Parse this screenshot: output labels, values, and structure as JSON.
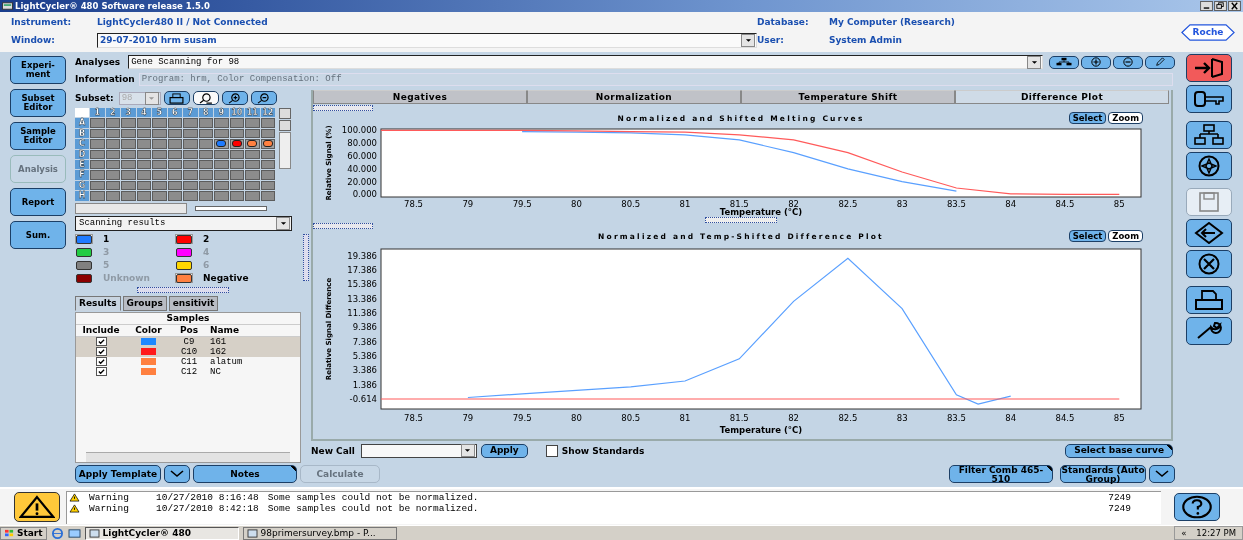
{
  "window": {
    "title": "LightCycler® 480 Software release 1.5.0"
  },
  "header": {
    "instrument_label": "Instrument:",
    "instrument": "LightCycler480 II / Not Connected",
    "window_label": "Window:",
    "window_value": "29-07-2010 hrm susam",
    "database_label": "Database:",
    "database": "My Computer (Research)",
    "user_label": "User:",
    "user": "System Admin",
    "logo": "Roche"
  },
  "nav": [
    {
      "label": "Experi-ment",
      "disabled": false
    },
    {
      "label": "Subset Editor",
      "disabled": false
    },
    {
      "label": "Sample Editor",
      "disabled": false
    },
    {
      "label": "Analysis",
      "disabled": true
    },
    {
      "label": "Report",
      "disabled": false
    },
    {
      "label": "Sum.",
      "disabled": false
    }
  ],
  "analyses": {
    "label": "Analyses",
    "value": "Gene Scanning for 98",
    "info_label": "Information",
    "info_placeholder": "Program: hrm, Color Compensation: Off"
  },
  "subset": {
    "label": "Subset:",
    "value": "98"
  },
  "plate": {
    "columns": [
      "1",
      "2",
      "3",
      "4",
      "5",
      "6",
      "7",
      "8",
      "9",
      "10",
      "11",
      "12"
    ],
    "rows": [
      {
        "label": "A",
        "wells": [
          {
            "occupied": false
          },
          {
            "occupied": false
          },
          {
            "occupied": false
          },
          {
            "occupied": false
          },
          {
            "occupied": false
          },
          {
            "occupied": false
          },
          {
            "occupied": false
          },
          {
            "occupied": false
          },
          {
            "occupied": false
          },
          {
            "occupied": false
          },
          {
            "occupied": false
          },
          {
            "occupied": false
          }
        ]
      },
      {
        "label": "B",
        "wells": [
          {
            "occupied": false
          },
          {
            "occupied": false
          },
          {
            "occupied": false
          },
          {
            "occupied": false
          },
          {
            "occupied": false
          },
          {
            "occupied": false
          },
          {
            "occupied": false
          },
          {
            "occupied": false
          },
          {
            "occupied": false
          },
          {
            "occupied": false
          },
          {
            "occupied": false
          },
          {
            "occupied": false
          }
        ]
      },
      {
        "label": "C",
        "wells": [
          {
            "occupied": false
          },
          {
            "occupied": false
          },
          {
            "occupied": false
          },
          {
            "occupied": false
          },
          {
            "occupied": false
          },
          {
            "occupied": false
          },
          {
            "occupied": false
          },
          {
            "occupied": false
          },
          {
            "occupied": true,
            "color": "#1e7bff"
          },
          {
            "occupied": true,
            "color": "#ff0000"
          },
          {
            "occupied": true,
            "color": "#ff8040"
          },
          {
            "occupied": true,
            "color": "#ff8040"
          }
        ]
      },
      {
        "label": "D",
        "wells": [
          {
            "occupied": false
          },
          {
            "occupied": false
          },
          {
            "occupied": false
          },
          {
            "occupied": false
          },
          {
            "occupied": false
          },
          {
            "occupied": false
          },
          {
            "occupied": false
          },
          {
            "occupied": false
          },
          {
            "occupied": false
          },
          {
            "occupied": false
          },
          {
            "occupied": false
          },
          {
            "occupied": false
          }
        ]
      },
      {
        "label": "E",
        "wells": [
          {
            "occupied": false
          },
          {
            "occupied": false
          },
          {
            "occupied": false
          },
          {
            "occupied": false
          },
          {
            "occupied": false
          },
          {
            "occupied": false
          },
          {
            "occupied": false
          },
          {
            "occupied": false
          },
          {
            "occupied": false
          },
          {
            "occupied": false
          },
          {
            "occupied": false
          },
          {
            "occupied": false
          }
        ]
      },
      {
        "label": "F",
        "wells": [
          {
            "occupied": false
          },
          {
            "occupied": false
          },
          {
            "occupied": false
          },
          {
            "occupied": false
          },
          {
            "occupied": false
          },
          {
            "occupied": false
          },
          {
            "occupied": false
          },
          {
            "occupied": false
          },
          {
            "occupied": false
          },
          {
            "occupied": false
          },
          {
            "occupied": false
          },
          {
            "occupied": false
          }
        ]
      },
      {
        "label": "G",
        "wells": [
          {
            "occupied": false
          },
          {
            "occupied": false
          },
          {
            "occupied": false
          },
          {
            "occupied": false
          },
          {
            "occupied": false
          },
          {
            "occupied": false
          },
          {
            "occupied": false
          },
          {
            "occupied": false
          },
          {
            "occupied": false
          },
          {
            "occupied": false
          },
          {
            "occupied": false
          },
          {
            "occupied": false
          }
        ]
      },
      {
        "label": "H",
        "wells": [
          {
            "occupied": false
          },
          {
            "occupied": false
          },
          {
            "occupied": false
          },
          {
            "occupied": false
          },
          {
            "occupied": false
          },
          {
            "occupied": false
          },
          {
            "occupied": false
          },
          {
            "occupied": false
          },
          {
            "occupied": false
          },
          {
            "occupied": false
          },
          {
            "occupied": false
          },
          {
            "occupied": false
          }
        ]
      }
    ]
  },
  "results_select": "Scanning results",
  "legend": [
    {
      "label": "1",
      "color": "#1e7bff",
      "active": true
    },
    {
      "label": "2",
      "color": "#ff0000",
      "active": true
    },
    {
      "label": "3",
      "color": "#22cc44",
      "active": false
    },
    {
      "label": "4",
      "color": "#ff00ff",
      "active": false
    },
    {
      "label": "5",
      "color": "#808080",
      "active": false
    },
    {
      "label": "6",
      "color": "#ffd700",
      "active": false
    },
    {
      "label": "Unknown",
      "color": "#8b0000",
      "active": false
    },
    {
      "label": "Negative",
      "color": "#ff8040",
      "active": true
    }
  ],
  "left_tabs": [
    {
      "label": "Results",
      "selected": true
    },
    {
      "label": "Groups",
      "selected": false
    },
    {
      "label": "ensitivit",
      "selected": false
    }
  ],
  "samples": {
    "title": "Samples",
    "columns": [
      "Include",
      "Color",
      "Pos",
      "Name"
    ],
    "rows": [
      {
        "include": true,
        "color": "#1e88ff",
        "pos": "C9",
        "name": "161",
        "selected": true
      },
      {
        "include": true,
        "color": "#ff1a1a",
        "pos": "C10",
        "name": "162",
        "selected": true
      },
      {
        "include": true,
        "color": "#ff8040",
        "pos": "C11",
        "name": "alatum",
        "selected": false
      },
      {
        "include": true,
        "color": "#ff8040",
        "pos": "C12",
        "name": "NC",
        "selected": false
      }
    ]
  },
  "chart_tabs": [
    {
      "label": "Negatives",
      "selected": false
    },
    {
      "label": "Normalization",
      "selected": false
    },
    {
      "label": "Temperature Shift",
      "selected": false
    },
    {
      "label": "Difference Plot",
      "selected": true
    }
  ],
  "charts": [
    {
      "select": "Select",
      "zoom": "Zoom",
      "chart_data": {
        "type": "line",
        "title": "Normalized and Shifted Melting Curves",
        "xlabel": "Temperature (°C)",
        "ylabel": "Relative Signal (%)",
        "x": [
          78.2,
          78.5,
          79,
          79.5,
          80,
          80.5,
          81,
          81.5,
          82,
          82.5,
          83,
          83.5,
          84,
          84.5,
          85
        ],
        "series": [
          {
            "color": "#5aa0ff",
            "values": [
              null,
              null,
              null,
              98,
              97,
              96,
              93,
              85,
              65,
              40,
              20,
              5,
              null,
              null,
              null
            ]
          },
          {
            "color": "#ff5a5a",
            "values": [
              100,
              100,
              100,
              100,
              99,
              98,
              97,
              93,
              85,
              65,
              35,
              10,
              1,
              0,
              0
            ]
          }
        ],
        "xlim": [
          78.2,
          85.2
        ],
        "ylim": [
          -4,
          102
        ],
        "xticks": [
          78.5,
          79,
          79.5,
          80,
          80.5,
          81,
          81.5,
          82,
          82.5,
          83,
          83.5,
          84,
          84.5,
          85
        ],
        "yticks": [
          {
            "value": 0,
            "label": "0.000"
          },
          {
            "value": 20,
            "label": "20.000"
          },
          {
            "value": 40,
            "label": "40.000"
          },
          {
            "value": 60,
            "label": "60.000"
          },
          {
            "value": 80,
            "label": "80.000"
          },
          {
            "value": 100,
            "label": "100.000"
          }
        ]
      }
    },
    {
      "select": "Select",
      "zoom": "Zoom",
      "chart_data": {
        "type": "line",
        "title": "Normalized and Temp-Shifted Difference Plot",
        "xlabel": "Temperature (°C)",
        "ylabel": "Relative Signal Difference",
        "x": [
          78.2,
          78.5,
          79,
          79.5,
          80,
          80.5,
          81,
          81.5,
          82,
          82.5,
          83,
          83.5,
          83.7,
          84,
          84.5,
          85
        ],
        "series": [
          {
            "color": "#5aa0ff",
            "values": [
              null,
              null,
              -0.4,
              0.1,
              0.6,
              1.1,
              1.9,
              5,
              13,
              19,
              12,
              0,
              -1.3,
              -0.2,
              null,
              null
            ]
          },
          {
            "color": "#ff5a5a",
            "values": [
              -0.6,
              -0.6,
              -0.6,
              -0.6,
              -0.6,
              -0.6,
              -0.6,
              -0.6,
              -0.6,
              -0.6,
              -0.6,
              -0.6,
              -0.6,
              -0.6,
              -0.6,
              -0.6
            ]
          }
        ],
        "xlim": [
          78.2,
          85.2
        ],
        "ylim": [
          -2,
          20.3
        ],
        "xticks": [
          78.5,
          79,
          79.5,
          80,
          80.5,
          81,
          81.5,
          82,
          82.5,
          83,
          83.5,
          84,
          84.5,
          85
        ],
        "yticks": [
          {
            "value": -0.614,
            "label": "-0.614"
          },
          {
            "value": 1.386,
            "label": "1.386"
          },
          {
            "value": 3.386,
            "label": "3.386"
          },
          {
            "value": 5.386,
            "label": "5.386"
          },
          {
            "value": 7.386,
            "label": "7.386"
          },
          {
            "value": 9.386,
            "label": "9.386"
          },
          {
            "value": 11.386,
            "label": "11.386"
          },
          {
            "value": 13.386,
            "label": "13.386"
          },
          {
            "value": 15.386,
            "label": "15.386"
          },
          {
            "value": 17.386,
            "label": "17.386"
          },
          {
            "value": 19.386,
            "label": "19.386"
          }
        ]
      }
    }
  ],
  "new_call": {
    "label": "New Call",
    "apply": "Apply",
    "show_standards": {
      "label": "Show Standards",
      "checked": false
    },
    "select_base": "Select base curve"
  },
  "bottom_buttons": {
    "apply_template": "Apply Template",
    "notes": "Notes",
    "calculate": {
      "label": "Calculate",
      "disabled": true
    },
    "filter": "Filter Comb 465-510",
    "standards": "Standards (Auto Group)"
  },
  "log": [
    {
      "level": "Warning",
      "time": "10/27/2010 8:16:48",
      "message": "Some samples could not be normalized.",
      "code": "7249"
    },
    {
      "level": "Warning",
      "time": "10/27/2010 8:42:18",
      "message": "Some samples could not be normalized.",
      "code": "7249"
    }
  ],
  "taskbar": {
    "start": "Start",
    "tasks": [
      {
        "label": "LightCycler® 480",
        "selected": true
      },
      {
        "label": "98primersurvey.bmp - P...",
        "selected": false
      }
    ],
    "tray": "«",
    "clock": "12:27 PM"
  }
}
